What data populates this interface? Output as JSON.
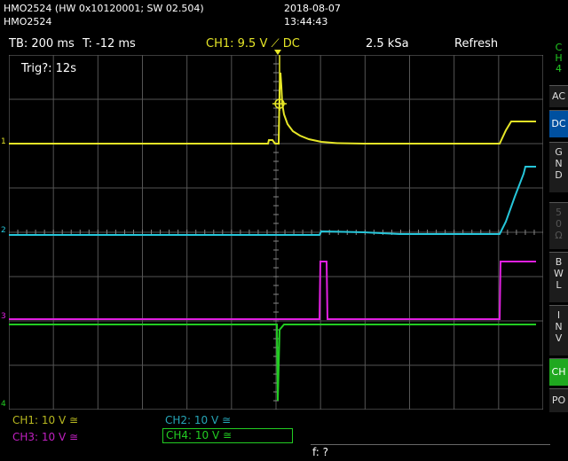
{
  "header": {
    "model_line": "HMO2524 (HW 0x10120001; SW 02.504)",
    "model": "HMO2524",
    "date": "2018-08-07",
    "time": "13:44:43"
  },
  "statusbar": {
    "timebase": "TB: 200 ms",
    "trigger_time": "T: -12 ms",
    "ch1_trigger": "CH1: 9.5 V ⟋ DC",
    "sample_rate": "2.5 kSa",
    "mode": "Refresh"
  },
  "screen": {
    "trig_text": "Trig?: 12s"
  },
  "markers": {
    "ch1": "1",
    "ch2": "2",
    "ch3": "3",
    "ch4": "4"
  },
  "side_panel": {
    "ch4_label": [
      "C",
      "H",
      "4"
    ],
    "ac": "AC",
    "dc": "DC",
    "gnd": [
      "G",
      "N",
      "D"
    ],
    "fifty": [
      "5",
      "0",
      "Ω"
    ],
    "bwl": [
      "B",
      "W",
      "L"
    ],
    "inv": [
      "I",
      "N",
      "V"
    ],
    "ch": "CH",
    "po": "PO"
  },
  "channels": {
    "ch1": "CH1: 10 V ≅",
    "ch2": "CH2: 10 V ≅",
    "ch3": "CH3: 10 V ≅",
    "ch4": "CH4: 10 V ≅"
  },
  "footer": {
    "freq": "f: ?"
  },
  "colors": {
    "ch1": "#e6e627",
    "ch2": "#26c6da",
    "ch3": "#e020e0",
    "ch4": "#22cc22",
    "grid": "#555555"
  }
}
